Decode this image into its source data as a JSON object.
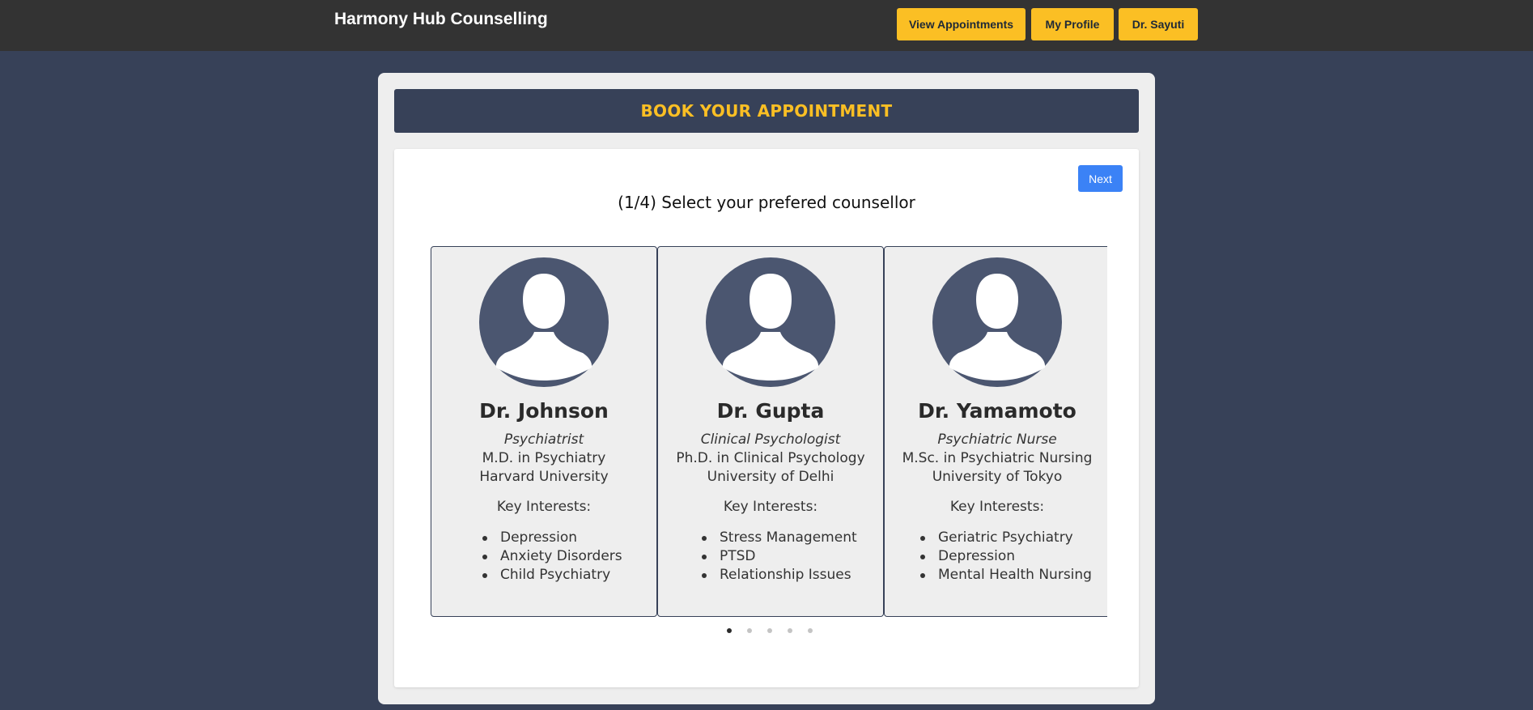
{
  "header": {
    "brand": "Harmony Hub Counselling",
    "nav": [
      {
        "label": "View Appointments"
      },
      {
        "label": "My Profile"
      },
      {
        "label": "Dr. Sayuti"
      }
    ]
  },
  "booking": {
    "banner": "BOOK YOUR APPOINTMENT",
    "next_label": "Next",
    "step_title": "(1/4) Select your prefered counsellor",
    "key_interests_label": "Key Interests:",
    "counsellors": [
      {
        "name": "Dr. Johnson",
        "role": "Psychiatrist",
        "degree": "M.D. in Psychiatry",
        "school": "Harvard University",
        "interests": [
          "Depression",
          "Anxiety Disorders",
          "Child Psychiatry"
        ]
      },
      {
        "name": "Dr. Gupta",
        "role": "Clinical Psychologist",
        "degree": "Ph.D. in Clinical Psychology",
        "school": "University of Delhi",
        "interests": [
          "Stress Management",
          "PTSD",
          "Relationship Issues"
        ]
      },
      {
        "name": "Dr. Yamamoto",
        "role": "Psychiatric Nurse",
        "degree": "M.Sc. in Psychiatric Nursing",
        "school": "University of Tokyo",
        "interests": [
          "Geriatric Psychiatry",
          "Depression",
          "Mental Health Nursing"
        ]
      }
    ],
    "pagination": {
      "total": 5,
      "active": 1
    }
  },
  "colors": {
    "page_bg": "#374158",
    "topbar_bg": "#333333",
    "accent": "#fbbf24",
    "next_button": "#3b82f6",
    "avatar_bg": "#4b5670"
  },
  "icons": {
    "avatar": "user-silhouette-icon"
  }
}
